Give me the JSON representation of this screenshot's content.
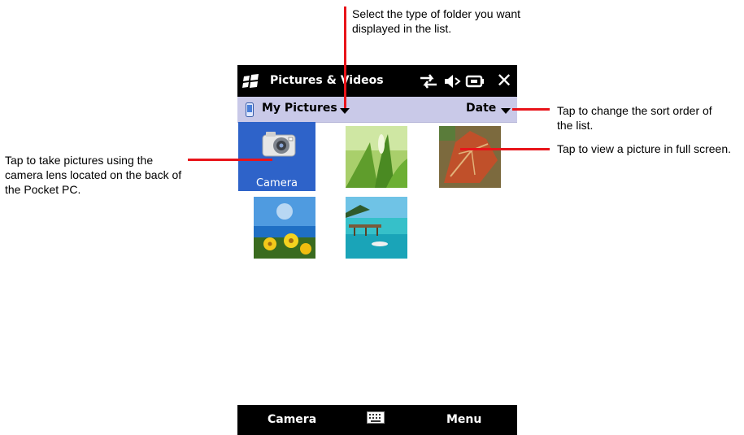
{
  "callouts": {
    "folder_type": "Select the type of folder you want displayed in the list.",
    "sort_order": "Tap to change the sort order of the list.",
    "view_picture": "Tap to view a picture in full screen.",
    "take_pictures": "Tap to take pictures using the camera lens located on the back of the Pocket PC."
  },
  "titlebar": {
    "title": "Pictures & Videos",
    "icons": [
      "windows-start-icon",
      "connectivity-icon",
      "volume-icon",
      "battery-icon",
      "close-icon"
    ],
    "close_glyph": "✕"
  },
  "header": {
    "folder": "My Pictures",
    "sort": "Date"
  },
  "grid": {
    "camera_caption": "Camera",
    "thumbnails": [
      "grass-photo",
      "autumn-leaf-photo",
      "yellow-flowers-photo",
      "beach-pier-photo"
    ]
  },
  "softkeys": {
    "left": "Camera",
    "right": "Menu"
  },
  "colors": {
    "callout_line": "#e8141a",
    "header_bar": "#c9c9e8",
    "camera_tile": "#2e63c9",
    "title_bar": "#000000"
  }
}
